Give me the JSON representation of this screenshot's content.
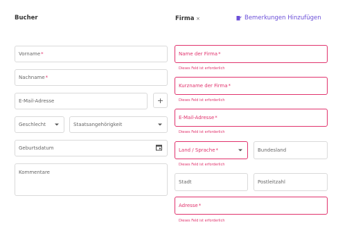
{
  "left": {
    "title": "Bucher",
    "firstname": {
      "label": "Vorname",
      "required": "*"
    },
    "lastname": {
      "label": "Nachname",
      "required": "*"
    },
    "email": {
      "label": "E-Mail-Adresse"
    },
    "add_button": "+",
    "gender": {
      "label": "Geschlecht"
    },
    "nationality": {
      "label": "Staatsangehörigkeit"
    },
    "birthdate": {
      "label": "Geburtsdatum"
    },
    "comments": {
      "label": "Kommentare"
    }
  },
  "right": {
    "title": "Firma",
    "close": "×",
    "add_notes": "Bemerkungen Hinzufügen",
    "company_name": {
      "label": "Name der Firma",
      "required": "*"
    },
    "short_name": {
      "label": "Kurzname der Firma",
      "required": "*"
    },
    "email": {
      "label": "E-Mail-Adresse",
      "required": "*"
    },
    "country_lang": {
      "label": "Land / Sprache",
      "required": "*"
    },
    "state": {
      "label": "Bundesland"
    },
    "city": {
      "label": "Stadt"
    },
    "zip": {
      "label": "Postleitzahl"
    },
    "address": {
      "label": "Adresse",
      "required": "*"
    },
    "error_message": "Dieses Feld ist erforderlich"
  },
  "colors": {
    "error": "#e0306b",
    "accent": "#6b4fd8",
    "border": "#d9d9d9"
  }
}
